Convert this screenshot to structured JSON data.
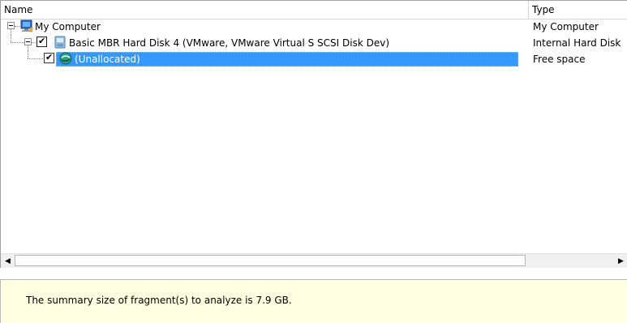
{
  "columns": {
    "name": "Name",
    "type": "Type"
  },
  "rows": [
    {
      "label": "My Computer",
      "type": "My Computer",
      "icon": "computer-icon"
    },
    {
      "label": "Basic MBR Hard Disk 4 (VMware, VMware Virtual S SCSI Disk Dev)",
      "type": "Internal Hard Disk",
      "icon": "hard-disk-icon",
      "checked": true
    },
    {
      "label": "(Unallocated)",
      "type": "Free space",
      "icon": "unallocated-space-icon",
      "checked": true,
      "selected": true
    }
  ],
  "scrollbar": {
    "left_arrow": "◀",
    "right_arrow": "▶"
  },
  "summary": {
    "text": "The summary size of fragment(s) to analyze is 7.9 GB."
  },
  "colors": {
    "selection": "#3399ff",
    "summary_bg": "#ffffe1"
  }
}
